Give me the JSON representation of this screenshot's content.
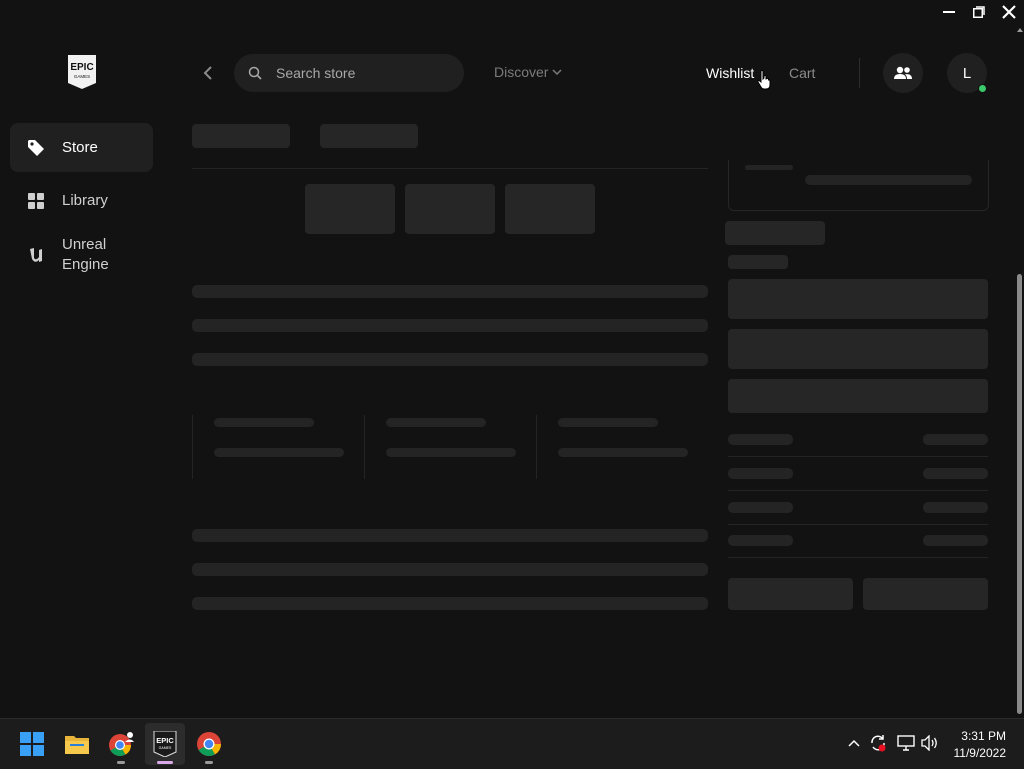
{
  "window": {
    "minimize_icon": "minimize-icon",
    "restore_icon": "restore-icon",
    "close_icon": "close-icon"
  },
  "brand": {
    "logo": "epic-games-logo",
    "logo_text_top": "EPIC",
    "logo_text_bottom": "GAMES"
  },
  "sidebar": {
    "items": [
      {
        "label": "Store",
        "icon": "tag-icon",
        "active": true
      },
      {
        "label": "Library",
        "icon": "grid-icon",
        "active": false
      },
      {
        "label": "Unreal Engine",
        "icon": "unreal-icon",
        "active": false
      }
    ]
  },
  "topbar": {
    "search_placeholder": "Search store",
    "discover_label": "Discover",
    "wishlist_label": "Wishlist",
    "cart_label": "Cart",
    "avatar_initial": "L",
    "online_color": "#3cc96b"
  },
  "taskbar": {
    "apps": [
      "windows-start",
      "file-explorer",
      "chrome-profile",
      "epic-games-launcher",
      "chrome"
    ],
    "clock": {
      "time": "3:31 PM",
      "date": "11/9/2022"
    }
  },
  "colors": {
    "background": "#121212",
    "skeleton": "#262626",
    "accent_text": "#ffffff"
  }
}
